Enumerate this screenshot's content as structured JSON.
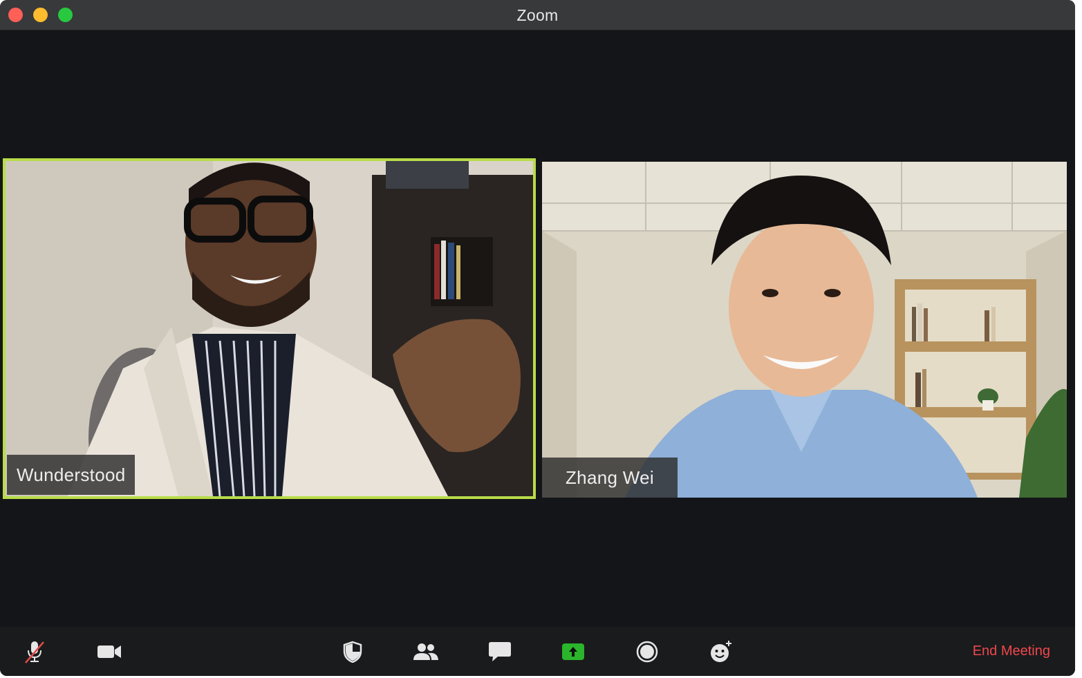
{
  "window": {
    "title": "Zoom"
  },
  "participants": [
    {
      "name": "Wunderstood",
      "active_speaker": true
    },
    {
      "name": "Zhang Wei",
      "active_speaker": false
    }
  ],
  "toolbar": {
    "buttons": [
      "microphone-muted-icon",
      "video-camera-icon",
      "security-shield-icon",
      "participants-icon",
      "chat-icon",
      "share-screen-icon",
      "record-icon",
      "reactions-icon"
    ],
    "end_label": "End Meeting"
  },
  "colors": {
    "active_speaker_border": "#b8dc4a",
    "share_green": "#2bb52c",
    "end_red": "#f0474c"
  }
}
